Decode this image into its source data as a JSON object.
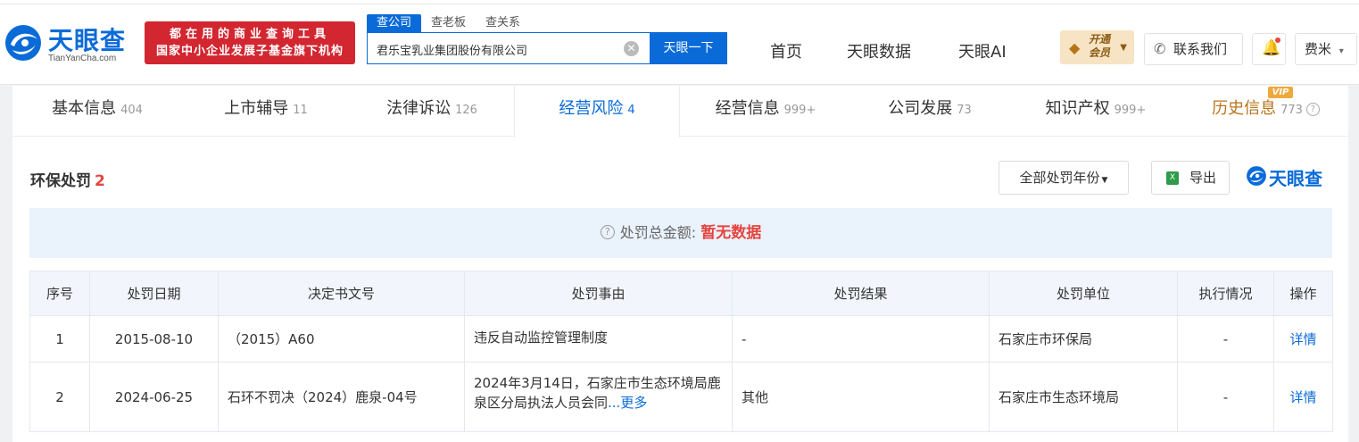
{
  "header": {
    "logo_name": "天眼查",
    "logo_sub": "TianYanCha.com",
    "banner_line1": "都在用的商业查询工具",
    "banner_line2": "国家中小企业发展子基金旗下机构",
    "search_tabs": [
      "查公司",
      "查老板",
      "查关系"
    ],
    "search_value": "君乐宝乳业集团股份有限公司",
    "search_button": "天眼一下",
    "nav": [
      "首页",
      "天眼数据",
      "天眼AI"
    ],
    "vip_line1": "开通",
    "vip_line2": "会员",
    "contact": "联系我们",
    "user": "费米"
  },
  "tabs": [
    {
      "label": "基本信息",
      "count": "404"
    },
    {
      "label": "上市辅导",
      "count": "11"
    },
    {
      "label": "法律诉讼",
      "count": "126"
    },
    {
      "label": "经营风险",
      "count": "4"
    },
    {
      "label": "经营信息",
      "count": "999+"
    },
    {
      "label": "公司发展",
      "count": "73"
    },
    {
      "label": "知识产权",
      "count": "999+"
    },
    {
      "label": "历史信息",
      "count": "773"
    }
  ],
  "vip_tag": "VIP",
  "section": {
    "title": "环保处罚",
    "count": "2",
    "year_select": "全部处罚年份",
    "export": "导出",
    "watermark": "天眼查"
  },
  "summary": {
    "label": "处罚总金额:",
    "value": "暂无数据"
  },
  "table": {
    "headers": [
      "序号",
      "处罚日期",
      "决定书文号",
      "处罚事由",
      "处罚结果",
      "处罚单位",
      "执行情况",
      "操作"
    ],
    "rows": [
      {
        "index": "1",
        "date": "2015-08-10",
        "doc_no": "（2015）A60",
        "reason": "违反自动监控管理制度",
        "result": "-",
        "unit": "石家庄市环保局",
        "execution": "-",
        "action": "详情"
      },
      {
        "index": "2",
        "date": "2024-06-25",
        "doc_no": "石环不罚决（2024）鹿泉-04号",
        "reason": "2024年3月14日，石家庄市生态环境局鹿泉区分局执法人员会同",
        "more": "...更多",
        "result": "其他",
        "unit": "石家庄市生态环境局",
        "execution": "-",
        "action": "详情"
      }
    ]
  }
}
